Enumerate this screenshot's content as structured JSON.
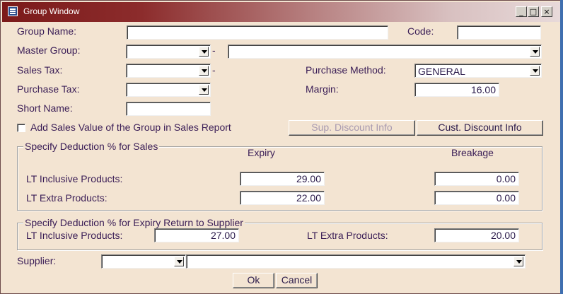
{
  "window": {
    "title": "Group Window",
    "min": "_",
    "max": "□",
    "close": "×"
  },
  "fields": {
    "group_name": {
      "label": "Group Name:",
      "value": ""
    },
    "code": {
      "label": "Code:",
      "value": ""
    },
    "master_group": {
      "label": "Master Group:",
      "value": "",
      "separator": "-",
      "name_value": ""
    },
    "sales_tax": {
      "label": "Sales Tax:",
      "value": "",
      "separator": "-"
    },
    "purchase_method": {
      "label": "Purchase Method:",
      "value": "GENERAL"
    },
    "purchase_tax": {
      "label": "Purchase Tax:",
      "value": ""
    },
    "margin": {
      "label": "Margin:",
      "value": "16.00"
    },
    "short_name": {
      "label": "Short Name:",
      "value": ""
    }
  },
  "checkbox": {
    "label": "Add Sales Value of the Group in Sales Report",
    "checked": false
  },
  "buttons": {
    "sup_discount": "Sup. Discount Info",
    "cust_discount": "Cust. Discount Info",
    "ok": "Ok",
    "cancel": "Cancel"
  },
  "sales_group": {
    "title": "Specify Deduction % for Sales",
    "col_expiry": "Expiry",
    "col_breakage": "Breakage",
    "rows": [
      {
        "label": "LT Inclusive Products:",
        "expiry": "29.00",
        "breakage": "0.00"
      },
      {
        "label": "LT Extra Products:",
        "expiry": "22.00",
        "breakage": "0.00"
      }
    ]
  },
  "supplier_group": {
    "title": "Specify Deduction % for Expiry Return to Supplier",
    "inclusive_label": "LT Inclusive Products:",
    "inclusive_value": "27.00",
    "extra_label": "LT Extra Products:",
    "extra_value": "20.00"
  },
  "supplier": {
    "label": "Supplier:",
    "value": "",
    "name_value": ""
  }
}
